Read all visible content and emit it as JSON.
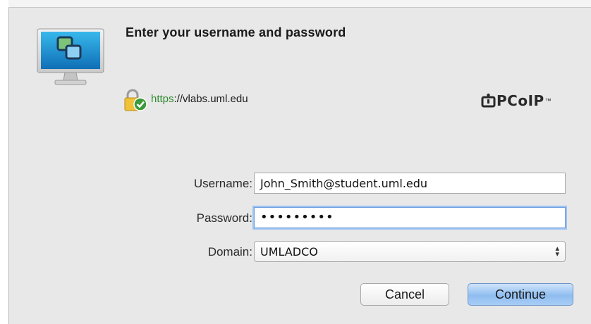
{
  "dialog": {
    "heading": "Enter your username and password",
    "url_scheme": "https",
    "url_rest": "://vlabs.uml.edu",
    "logo": {
      "name": "PCoIP",
      "tm": "™"
    },
    "username": {
      "label": "Username:",
      "value": "John_Smith@student.uml.edu"
    },
    "password": {
      "label": "Password:",
      "masked_value": "•••••••••"
    },
    "domain": {
      "label": "Domain:",
      "selected": "UMLADCO"
    },
    "cancel_label": "Cancel",
    "continue_label": "Continue"
  },
  "colors": {
    "https_green": "#2e8b2e",
    "focus_ring": "#9cc2f2",
    "default_button": "#8fbdf0"
  },
  "icons": {
    "app": "remote-desktop-monitor-icon",
    "secure": "lock-with-check-icon",
    "select_arrows": "up-down-arrows-icon"
  }
}
